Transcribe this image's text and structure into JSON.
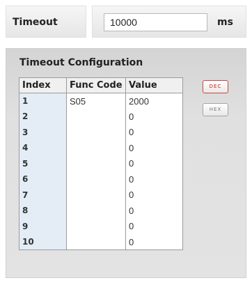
{
  "timeout": {
    "label": "Timeout",
    "value": "10000",
    "unit": "ms"
  },
  "config": {
    "title": "Timeout Configuration",
    "columns": [
      "Index",
      "Func Code",
      "Value"
    ],
    "rows": [
      {
        "index": "1",
        "func_code": "S05",
        "value": "2000"
      },
      {
        "index": "2",
        "func_code": "",
        "value": "0"
      },
      {
        "index": "3",
        "func_code": "",
        "value": "0"
      },
      {
        "index": "4",
        "func_code": "",
        "value": "0"
      },
      {
        "index": "5",
        "func_code": "",
        "value": "0"
      },
      {
        "index": "6",
        "func_code": "",
        "value": "0"
      },
      {
        "index": "7",
        "func_code": "",
        "value": "0"
      },
      {
        "index": "8",
        "func_code": "",
        "value": "0"
      },
      {
        "index": "9",
        "func_code": "",
        "value": "0"
      },
      {
        "index": "10",
        "func_code": "",
        "value": "0"
      }
    ]
  },
  "mode_buttons": {
    "dec": "DEC",
    "hex": "HEX",
    "active": "dec",
    "active_color": "#d61a1a"
  }
}
